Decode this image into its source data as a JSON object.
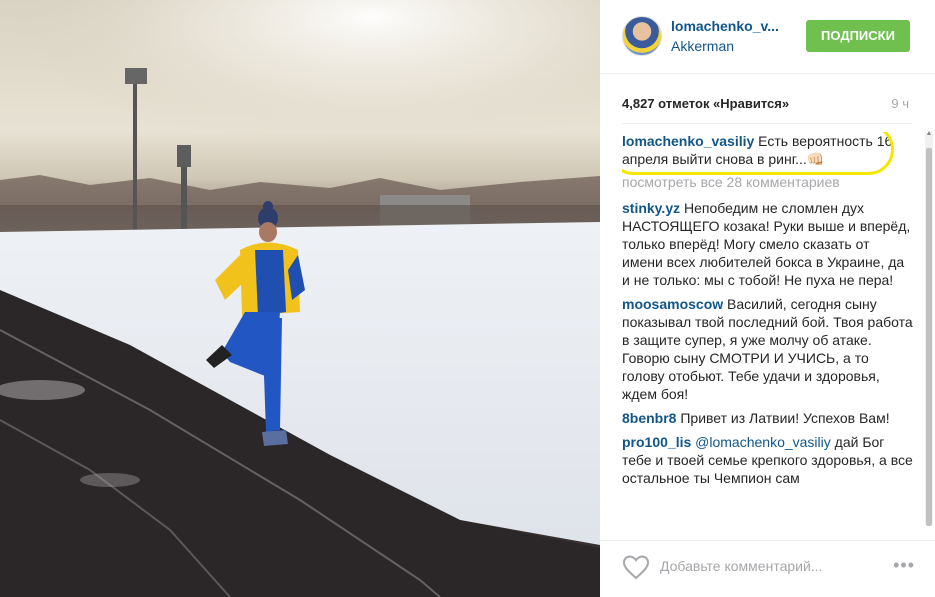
{
  "colors": {
    "link": "#125688",
    "follow_button": "#70c050",
    "highlight_ring": "#f5e600",
    "muted": "#a5a7aa"
  },
  "post": {
    "photo_alt": "Man in blue and yellow tracksuit jogging on a snowy stadium track"
  },
  "header": {
    "username": "lomachenko_v...",
    "location": "Akkerman",
    "follow_label": "ПОДПИСКИ",
    "avatar_icon": "avatar-icon"
  },
  "stats": {
    "likes": "4,827 отметок «Нравится»",
    "time": "9 ч"
  },
  "caption": {
    "user": "lomachenko_vasiliy",
    "text": " Есть вероятность 16 апреля выйти снова в ринг...👊🏻"
  },
  "view_all": "посмотреть все 28 комментариев",
  "comments": [
    {
      "user": "stinky.yz",
      "text": " Непобедим не сломлен дух НАСТОЯЩЕГО козака! Руки выше и вперёд, только вперёд! Могу смело сказать от имени всех любителей бокса в Украине, да и не только: мы с тобой! Не пуха не пера!"
    },
    {
      "user": "moosamoscow",
      "text": " Василий, сегодня сыну показывал твой последний бой. Твоя работа в защите супер, я уже молчу об атаке. Говорю сыну СМОТРИ И УЧИСЬ, а то голову отобьют. Тебе удачи и здоровья, ждем боя!"
    },
    {
      "user": "8benbr8",
      "text": " Привет из Латвии! Успехов Вам!"
    },
    {
      "user": "pro100_lis",
      "mention": "@lomachenko_vasiliy",
      "text": " дай Бог тебе и твоей семье крепкого здоровья, а все остальное ты Чемпион сам"
    }
  ],
  "footer": {
    "comment_placeholder": "Добавьте комментарий...",
    "more_label": "•••",
    "like_icon": "heart-icon",
    "more_icon": "more-options-icon"
  }
}
